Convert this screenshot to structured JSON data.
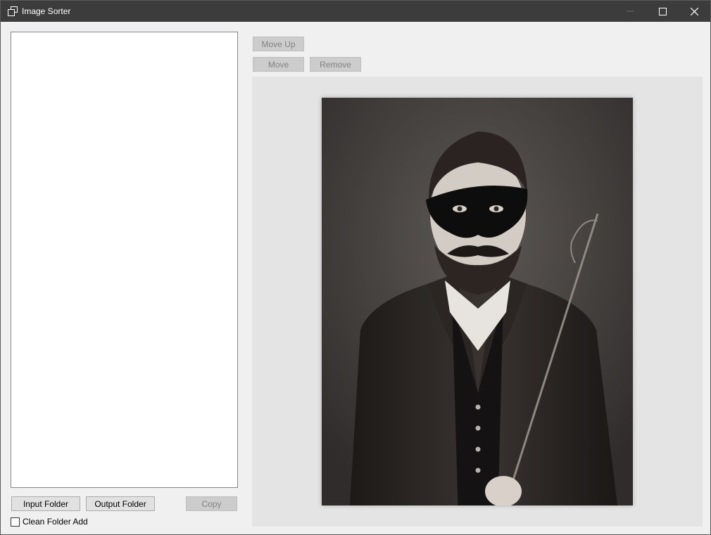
{
  "window": {
    "title": "Image Sorter"
  },
  "titlebar": {
    "app_icon": "window-restore-icon",
    "minimize_icon": "minimize-icon",
    "maximize_icon": "maximize-icon",
    "close_icon": "close-icon"
  },
  "left_panel": {
    "input_folder_label": "Input Folder",
    "output_folder_label": "Output Folder",
    "copy_label": "Copy",
    "clean_folder_add_label": "Clean Folder Add",
    "clean_folder_add_checked": false
  },
  "toolbar": {
    "move_up_label": "Move Up",
    "move_label": "Move",
    "remove_label": "Remove"
  },
  "preview": {
    "image": "portrait-photo"
  },
  "colors": {
    "titlebar_bg": "#3c3c3c",
    "window_bg": "#f0f0f0",
    "preview_bg": "#e4e4e4"
  }
}
